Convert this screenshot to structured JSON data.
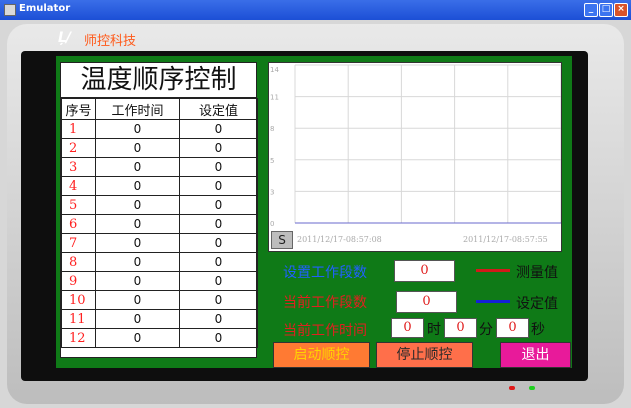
{
  "window": {
    "title": "Emulator",
    "controls": [
      "minimize",
      "maximize",
      "close"
    ]
  },
  "logo": {
    "mark": "Ļ/",
    "text": "师控科技"
  },
  "table": {
    "title": "温度顺序控制",
    "headers": [
      "序号",
      "工作时间",
      "设定值"
    ],
    "rows": [
      {
        "idx": "1",
        "time": "0",
        "value": "0"
      },
      {
        "idx": "2",
        "time": "0",
        "value": "0"
      },
      {
        "idx": "3",
        "time": "0",
        "value": "0"
      },
      {
        "idx": "4",
        "time": "0",
        "value": "0"
      },
      {
        "idx": "5",
        "time": "0",
        "value": "0"
      },
      {
        "idx": "6",
        "time": "0",
        "value": "0"
      },
      {
        "idx": "7",
        "time": "0",
        "value": "0"
      },
      {
        "idx": "8",
        "time": "0",
        "value": "0"
      },
      {
        "idx": "9",
        "time": "0",
        "value": "0"
      },
      {
        "idx": "10",
        "time": "0",
        "value": "0"
      },
      {
        "idx": "11",
        "time": "0",
        "value": "0"
      },
      {
        "idx": "12",
        "time": "0",
        "value": "0"
      }
    ]
  },
  "chart": {
    "y_ticks": [
      "14",
      "11",
      "8",
      "5",
      "3",
      "0"
    ],
    "scroll_label": "S",
    "time_start": "2011/12/17-08:57:08",
    "time_end": "2011/12/17-08:57:55"
  },
  "controls": {
    "set_segments_label": "设置工作段数",
    "set_segments_value": "0",
    "current_segment_label": "当前工作段数",
    "current_segment_value": "0",
    "current_time_label": "当前工作时间",
    "hours": "0",
    "hours_unit": "时",
    "minutes": "0",
    "minutes_unit": "分",
    "seconds": "0",
    "seconds_unit": "秒"
  },
  "legend": {
    "measured": "测量值",
    "measured_color": "#d11a1a",
    "setpoint": "设定值",
    "setpoint_color": "#1420d8"
  },
  "buttons": {
    "start": "启动顺控",
    "stop": "停止顺控",
    "exit": "退出"
  },
  "colors": {
    "screen_bg": "#0f7a17",
    "start_btn": "#ff7a33",
    "stop_btn": "#ff6f4a",
    "exit_btn": "#e81a9a"
  }
}
